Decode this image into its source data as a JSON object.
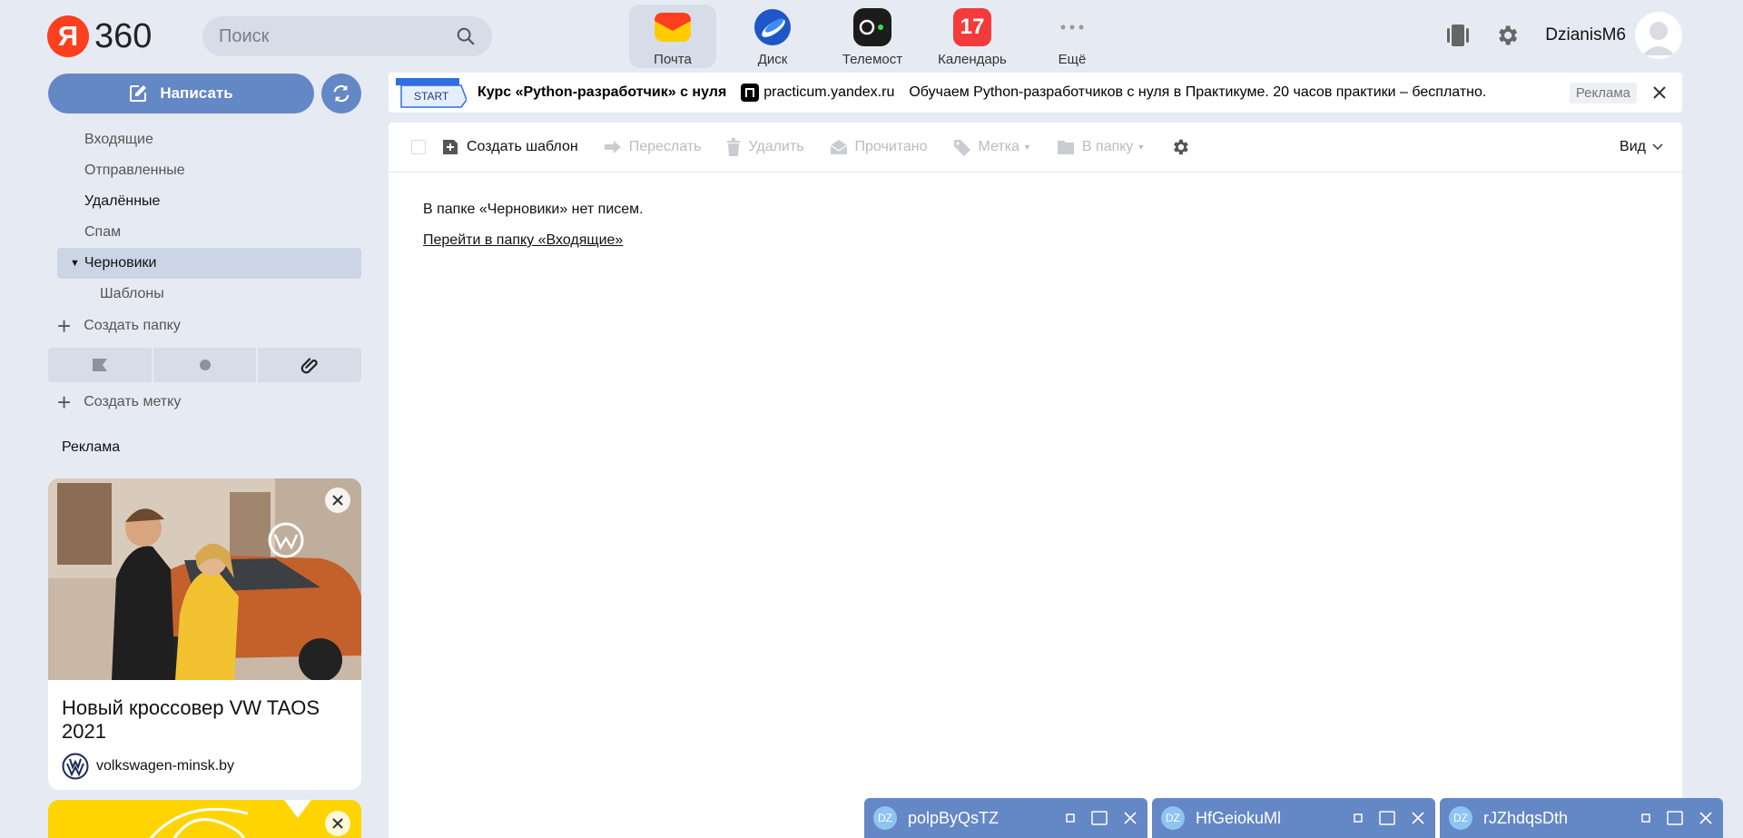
{
  "header": {
    "logo_letter": "Я",
    "logo_text": "360",
    "search_placeholder": "Поиск",
    "apps": [
      {
        "label": "Почта",
        "icon": "mail-icon",
        "color": "#fc3f1d"
      },
      {
        "label": "Диск",
        "icon": "disk-icon",
        "color": "#1a73e8"
      },
      {
        "label": "Телемост",
        "icon": "telemost-icon",
        "color": "#222222"
      },
      {
        "label": "Календарь",
        "icon": "calendar-icon",
        "badge": "17",
        "color": "#f33b3b"
      },
      {
        "label": "Ещё",
        "icon": "more-icon"
      }
    ],
    "username": "DzianisM6"
  },
  "sidebar": {
    "compose_label": "Написать",
    "folders": [
      {
        "label": "Входящие"
      },
      {
        "label": "Отправленные"
      },
      {
        "label": "Удалённые"
      },
      {
        "label": "Спам"
      },
      {
        "label": "Черновики",
        "active": true
      },
      {
        "label": "Шаблоны"
      }
    ],
    "create_folder": "Создать папку",
    "create_label": "Создать метку",
    "ad_label": "Реклама",
    "ad": {
      "title": "Новый кроссовер VW TAOS 2021",
      "domain": "volkswagen-minsk.by"
    }
  },
  "banner": {
    "badge": "START",
    "title": "Курс «Python-разработчик» с нуля",
    "domain": "practicum.yandex.ru",
    "text": "Обучаем Python-разработчиков с нуля в Практикуме. 20 часов практики – бесплатно.",
    "ad_label": "Реклама"
  },
  "toolbar": {
    "create_template": "Создать шаблон",
    "forward": "Переслать",
    "delete": "Удалить",
    "read": "Прочитано",
    "label": "Метка",
    "to_folder": "В папку",
    "view": "Вид"
  },
  "content": {
    "empty_message": "В папке «Черновики» нет писем.",
    "inbox_link": "Перейти в папку «Входящие»"
  },
  "chats": [
    {
      "initials": "DZ",
      "name": "polpByQsTZ"
    },
    {
      "initials": "DZ",
      "name": "HfGeiokuMl"
    },
    {
      "initials": "DZ",
      "name": "rJZhdqsDth"
    }
  ],
  "colors": {
    "accent": "#6487c6",
    "background": "#e6ebf3"
  }
}
